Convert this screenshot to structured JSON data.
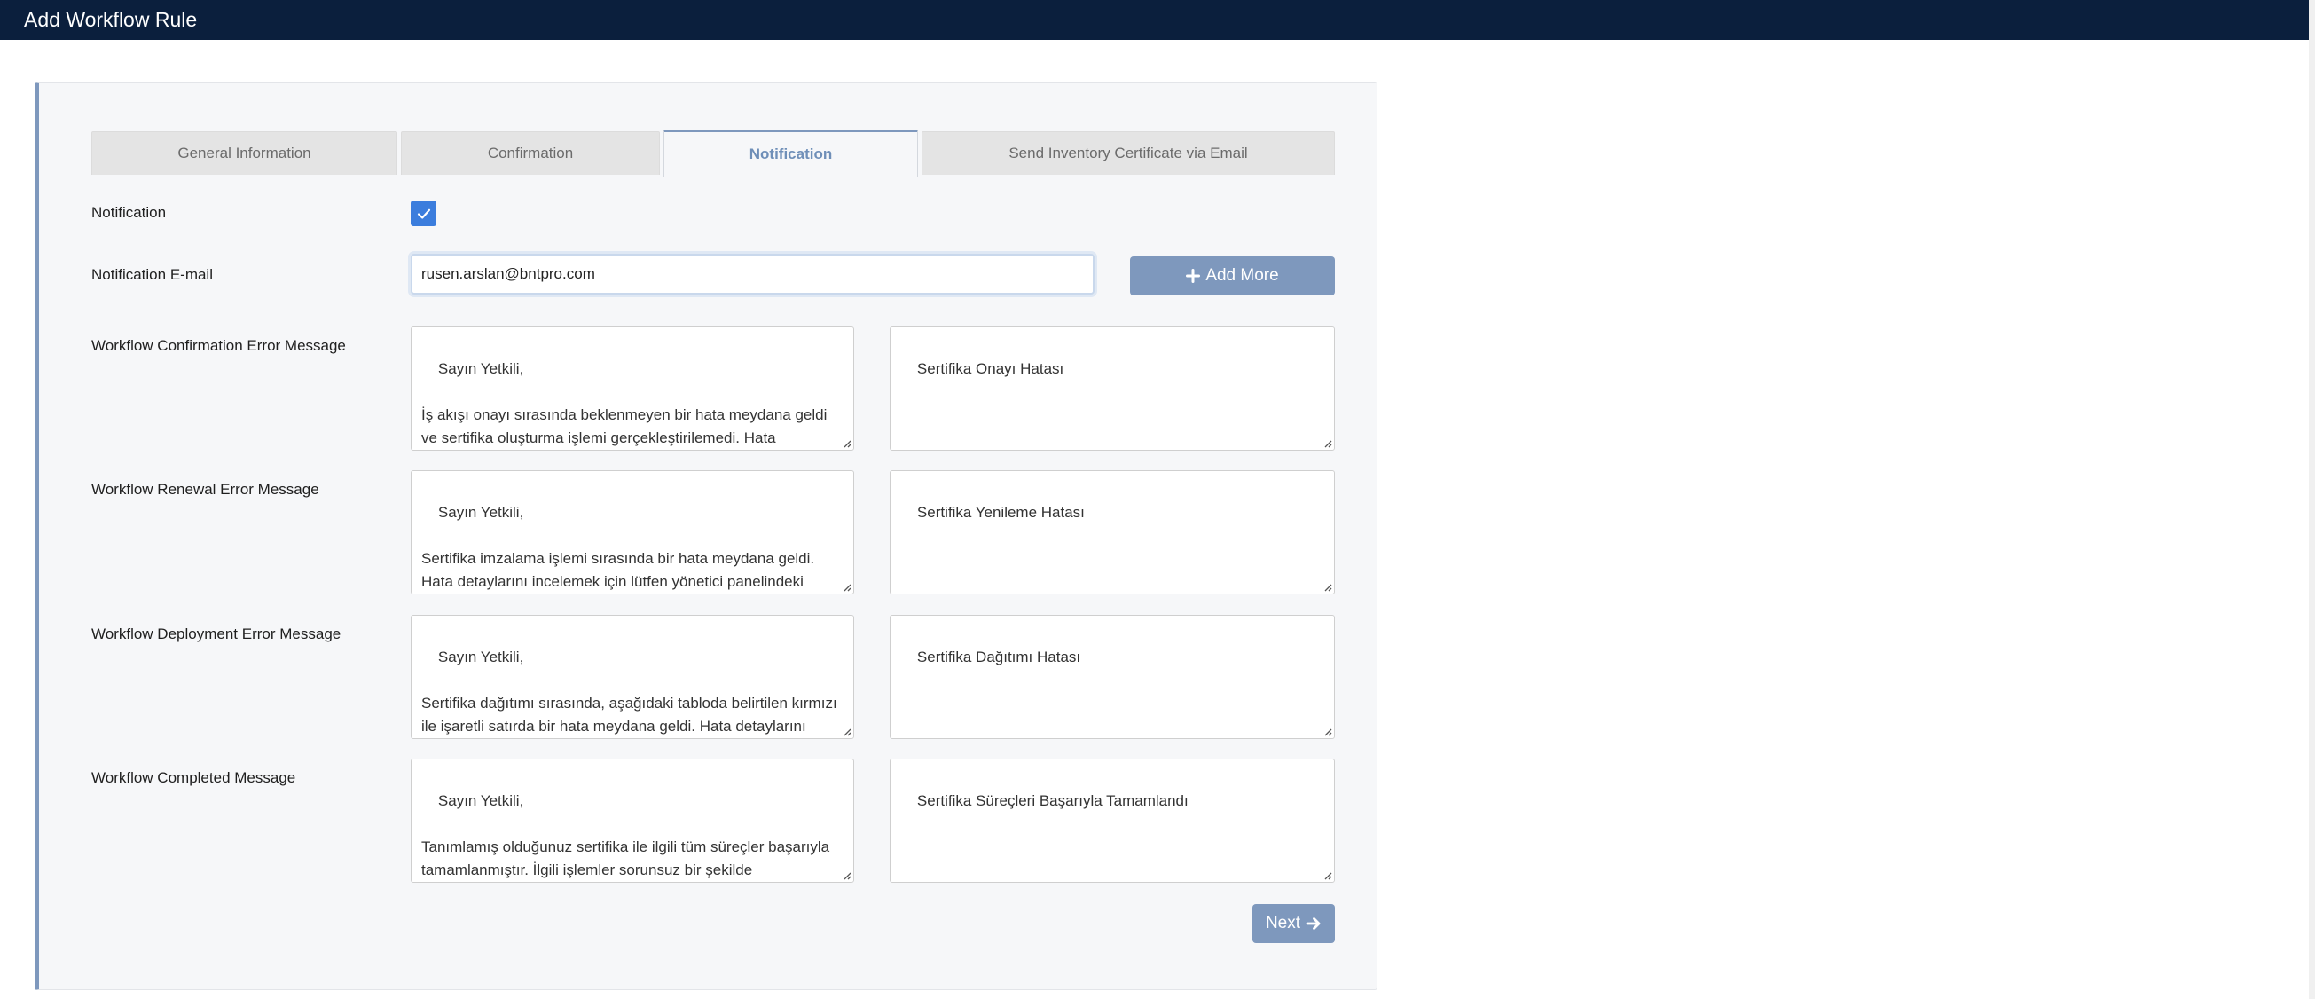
{
  "header": {
    "title": "Add Workflow Rule"
  },
  "tabs": [
    {
      "label": "General Information"
    },
    {
      "label": "Confirmation"
    },
    {
      "label": "Notification"
    },
    {
      "label": "Send Inventory Certificate via Email"
    }
  ],
  "active_tab": "Notification",
  "form": {
    "notification": {
      "label": "Notification",
      "checked": true
    },
    "email": {
      "label": "Notification E-mail",
      "value": "rusen.arslan@bntpro.com"
    },
    "add_more_label": "Add More",
    "rows": [
      {
        "label": "Workflow Confirmation Error Message",
        "body": "Sayın Yetkili,\n\nİş akışı onayı sırasında beklenmeyen bir hata meydana geldi ve sertifika oluşturma işlemi gerçekleştirilemedi. Hata detaylarını görmek için lütfen yönetici panelindeki System >",
        "subject": "Sertifika Onayı Hatası"
      },
      {
        "label": "Workflow Renewal Error Message",
        "body": "Sayın Yetkili,\n\nSertifika imzalama işlemi sırasında bir hata meydana geldi. Hata detaylarını incelemek için lütfen yönetici panelindeki System > Log > Workflow Logs bölümüne göz atın.",
        "subject": "Sertifika Yenileme Hatası"
      },
      {
        "label": "Workflow Deployment Error Message",
        "body": "Sayın Yetkili,\n\nSertifika dağıtımı sırasında, aşağıdaki tabloda belirtilen kırmızı ile işaretli satırda bir hata meydana geldi. Hata detaylarını incelemek için lütfen yönetici panelindeki System > Log >",
        "subject": "Sertifika Dağıtımı Hatası"
      },
      {
        "label": "Workflow Completed Message",
        "body": "Sayın Yetkili,\n\nTanımlamış olduğunuz sertifika ile ilgili tüm süreçler başarıyla tamamlanmıştır. İlgili işlemler sorunsuz bir şekilde gerçekleştirilmiştir.",
        "subject": "Sertifika Süreçleri Başarıyla Tamamlandı"
      }
    ],
    "next_label": "Next"
  },
  "colors": {
    "header_bg": "#0b1f3d",
    "accent": "#7e98bd",
    "checkbox": "#3b7ddd"
  },
  "icons": [
    "check-icon",
    "plus-icon",
    "arrow-right-icon",
    "resize-grip-icon"
  ]
}
